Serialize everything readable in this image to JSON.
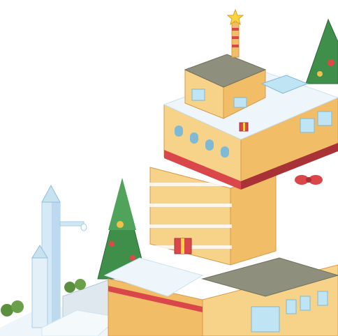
{
  "scene": {
    "description_tag": "",
    "palette": {
      "sky": "#ffffff",
      "snow": "#eef6fb",
      "snow_shadow": "#c9e2ef",
      "wall_light": "#f7d38a",
      "wall_mid": "#f1bd67",
      "wall_dark": "#d99a4a",
      "trim_red": "#d9474a",
      "trim_red_dark": "#a83236",
      "window": "#bfe4f4",
      "window_dark": "#7fb9d6",
      "tree_green": "#3f8f4a",
      "tree_dark": "#2b6b37",
      "star": "#ffd23f",
      "tower_blue": "#d6e9f6",
      "tower_shade": "#a9cde6",
      "ornament_red": "#e04848",
      "ornament_gold": "#f3c14b",
      "floor_gray": "#8e8f7c"
    },
    "icons": [
      "star-icon",
      "gift-box-icon",
      "christmas-tree-icon",
      "tower-icon",
      "ribbon-bow-icon"
    ]
  }
}
